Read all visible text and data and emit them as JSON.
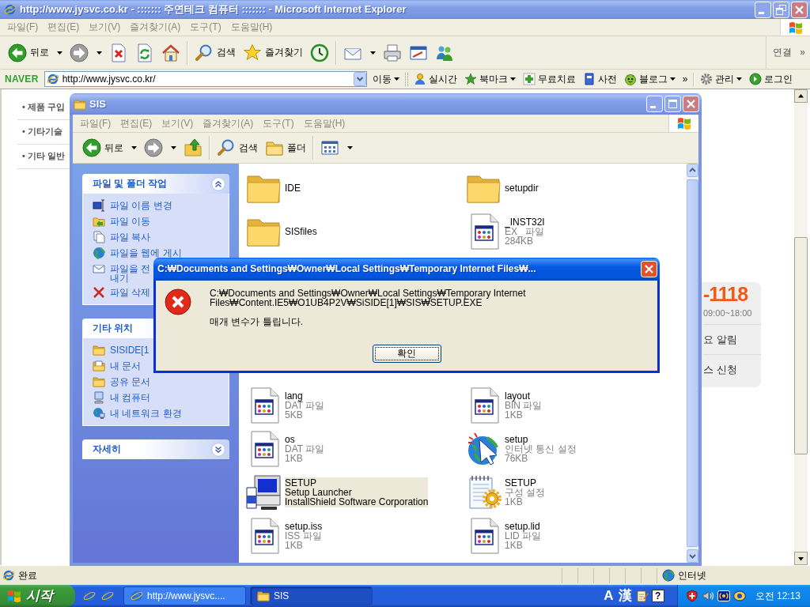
{
  "ie_window": {
    "title": "http://www.jysvc.co.kr - ::::::: 주연테크 컴퓨터 ::::::: - Microsoft Internet Explorer",
    "active": false,
    "menu": [
      "파일(F)",
      "편집(E)",
      "보기(V)",
      "즐겨찾기(A)",
      "도구(T)",
      "도움말(H)"
    ],
    "toolbar": [
      {
        "kind": "back",
        "label": "뒤로",
        "dropdown": true,
        "disabled": false
      },
      {
        "kind": "forward",
        "dropdown": true,
        "disabled": true
      },
      {
        "kind": "stop",
        "dropdown": false,
        "disabled": false
      },
      {
        "kind": "refresh",
        "dropdown": false,
        "disabled": false
      },
      {
        "kind": "home",
        "dropdown": false,
        "disabled": false
      },
      {
        "kind": "separator"
      },
      {
        "kind": "search",
        "label": "검색",
        "dropdown": false,
        "disabled": false
      },
      {
        "kind": "favorites",
        "label": "즐겨찾기",
        "dropdown": false,
        "disabled": false
      },
      {
        "kind": "history",
        "dropdown": false,
        "disabled": false
      },
      {
        "kind": "separator"
      },
      {
        "kind": "mail",
        "dropdown": true,
        "disabled": false
      },
      {
        "kind": "print",
        "dropdown": false,
        "disabled": false
      },
      {
        "kind": "edit",
        "dropdown": false,
        "disabled": false
      },
      {
        "kind": "messenger",
        "dropdown": false,
        "disabled": false
      }
    ],
    "links_label": "연결",
    "links_more": "»"
  },
  "naver_bar": {
    "logo": "NAVER",
    "address": "http://www.jysvc.co.kr/",
    "go_label": "이동",
    "items": [
      {
        "kind": "realtime",
        "label": "실시간",
        "dropdown": false
      },
      {
        "kind": "bookmark",
        "label": "북마크",
        "dropdown": true
      },
      {
        "kind": "health",
        "label": "무료치료",
        "dropdown": false
      },
      {
        "kind": "dictionary",
        "label": "사전",
        "dropdown": false
      },
      {
        "kind": "blog",
        "label": "블로그",
        "dropdown": true
      }
    ],
    "more": "»",
    "tools": [
      {
        "kind": "settings",
        "label": "관리",
        "dropdown": true
      },
      {
        "kind": "login",
        "label": "로그인",
        "dropdown": false
      }
    ]
  },
  "page": {
    "side_links": [
      "• 제품 구입",
      "• 기타기술",
      "• 기타 일반"
    ],
    "contact_card": {
      "phone": "-1118",
      "hours": "09:00~18:00",
      "links": [
        "요 알림",
        "스 신청"
      ]
    }
  },
  "status_bar": {
    "text": "완료",
    "zone": "인터넷"
  },
  "explorer_window": {
    "title": "SIS",
    "active": false,
    "menu": [
      "파일(F)",
      "편집(E)",
      "보기(V)",
      "즐겨찾기(A)",
      "도구(T)",
      "도움말(H)"
    ],
    "toolbar": [
      {
        "kind": "back",
        "label": "뒤로",
        "dropdown": true,
        "disabled": false
      },
      {
        "kind": "forward",
        "dropdown": true,
        "disabled": true
      },
      {
        "kind": "up",
        "dropdown": false,
        "disabled": false
      },
      {
        "kind": "separator"
      },
      {
        "kind": "search",
        "label": "검색",
        "dropdown": false,
        "disabled": false
      },
      {
        "kind": "folders",
        "label": "폴더",
        "dropdown": false,
        "disabled": false
      },
      {
        "kind": "separator"
      },
      {
        "kind": "views",
        "dropdown": true,
        "disabled": false
      }
    ],
    "task_panels": [
      {
        "title": "파일 및 폴더 작업",
        "expanded": true,
        "items": [
          {
            "kind": "rename",
            "label": "파일 이름 변경"
          },
          {
            "kind": "move",
            "label": "파일 이동"
          },
          {
            "kind": "copy",
            "label": "파일 복사"
          },
          {
            "kind": "publish",
            "label": "파일을 웹에 게시"
          },
          {
            "kind": "email",
            "label": "파일을 전\n내기"
          },
          {
            "kind": "delete",
            "label": "파일 삭제"
          }
        ]
      },
      {
        "title": "기타 위치",
        "items": [
          {
            "kind": "folder",
            "label": "SISIDE[1"
          },
          {
            "kind": "documents",
            "label": "내 문서"
          },
          {
            "kind": "shared",
            "label": "공유 문서"
          },
          {
            "kind": "computer",
            "label": "내 컴퓨터"
          },
          {
            "kind": "network",
            "label": "내 네트워크 환경"
          }
        ]
      },
      {
        "title": "자세히",
        "expanded": false
      }
    ],
    "files": [
      {
        "kind": "folder",
        "name": "IDE",
        "selected": false
      },
      {
        "kind": "folder",
        "name": "SISfiles",
        "selected": false
      },
      {
        "kind": "file",
        "name": "lang",
        "details": [
          "DAT 파일",
          "5KB"
        ],
        "selected": false
      },
      {
        "kind": "file",
        "name": "os",
        "details": [
          "DAT 파일",
          "1KB"
        ],
        "selected": false
      },
      {
        "kind": "program",
        "name": "SETUP",
        "details": [
          "Setup Launcher",
          "InstallShield Software Corporation"
        ],
        "selected": true
      },
      {
        "kind": "file",
        "name": "setup.iss",
        "details": [
          "ISS 파일",
          "1KB"
        ],
        "selected": false
      },
      {
        "kind": "folder",
        "name": "setupdir",
        "selected": false
      },
      {
        "kind": "file",
        "name": "_INST32I",
        "details": [
          "EX_ 파일",
          "284KB"
        ],
        "selected": false
      },
      {
        "kind": "file",
        "name": "layout",
        "details": [
          "BIN 파일",
          "1KB"
        ],
        "selected": false
      },
      {
        "kind": "internet",
        "name": "setup",
        "details": [
          "인터넷 통신 설정",
          "76KB"
        ],
        "selected": false
      },
      {
        "kind": "config",
        "name": "SETUP",
        "details": [
          "구성 설정",
          "1KB"
        ],
        "selected": false
      },
      {
        "kind": "file",
        "name": "setup.lid",
        "details": [
          "LID 파일",
          "1KB"
        ],
        "selected": false
      }
    ]
  },
  "dialog": {
    "title": "C:₩Documents and Settings₩Owner₩Local Settings₩Temporary Internet Files₩...",
    "active": true,
    "path": "C:₩Documents and Settings₩Owner₩Local Settings₩Temporary Internet Files₩Content.IE5₩O1UB4P2V₩SiSIDE[1]₩SIS₩SETUP.EXE",
    "message": "매개 변수가 틀립니다.",
    "button": {
      "label": "확인",
      "focused": true
    }
  },
  "taskbar": {
    "start": "시작",
    "tasks": [
      {
        "kind": "browser",
        "label": "http://www.jysvc....",
        "selected": false
      },
      {
        "kind": "folder",
        "label": "SIS",
        "selected": true
      }
    ],
    "language": [
      "A",
      "漢"
    ],
    "help": "?",
    "clock": "오전 12:13"
  }
}
